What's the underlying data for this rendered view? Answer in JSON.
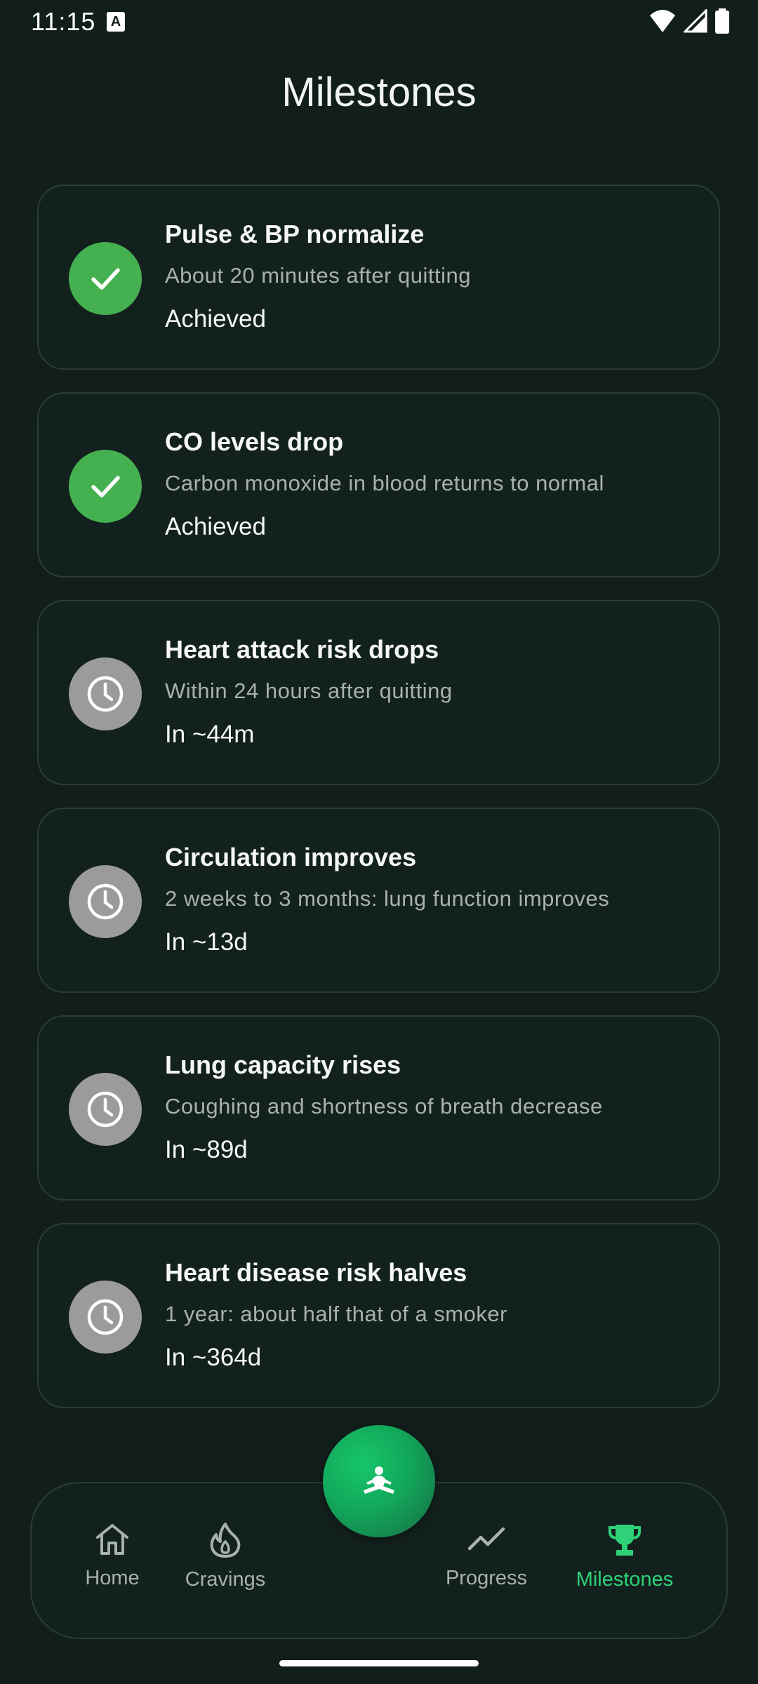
{
  "status_bar": {
    "time": "11:15",
    "notification_icon": "A"
  },
  "page": {
    "title": "Milestones"
  },
  "milestones": [
    {
      "title": "Pulse & BP normalize",
      "description": "About 20 minutes after quitting",
      "status": "Achieved",
      "state": "done",
      "icon": "check-icon"
    },
    {
      "title": "CO levels drop",
      "description": "Carbon monoxide in blood returns to normal",
      "status": "Achieved",
      "state": "done",
      "icon": "check-icon"
    },
    {
      "title": "Heart attack risk drops",
      "description": "Within 24 hours after quitting",
      "status": "In ~44m",
      "state": "pending",
      "icon": "clock-icon"
    },
    {
      "title": "Circulation improves",
      "description": "2 weeks to 3 months: lung function improves",
      "status": "In ~13d",
      "state": "pending",
      "icon": "clock-icon"
    },
    {
      "title": "Lung capacity rises",
      "description": "Coughing and shortness of breath decrease",
      "status": "In ~89d",
      "state": "pending",
      "icon": "clock-icon"
    },
    {
      "title": "Heart disease risk halves",
      "description": "1 year: about half that of a smoker",
      "status": "In ~364d",
      "state": "pending",
      "icon": "clock-icon"
    }
  ],
  "nav": {
    "items": [
      {
        "label": "Home",
        "icon": "home-icon"
      },
      {
        "label": "Cravings",
        "icon": "flame-icon"
      },
      {
        "label": "Progress",
        "icon": "trend-icon"
      },
      {
        "label": "Milestones",
        "icon": "trophy-icon",
        "active": true
      }
    ],
    "fab_icon": "meditation-icon"
  },
  "colors": {
    "background": "#111e1b",
    "card_background": "#13211e",
    "accent": "#2ed178",
    "achieved": "#44b04f",
    "pending": "#9b9b9b"
  }
}
